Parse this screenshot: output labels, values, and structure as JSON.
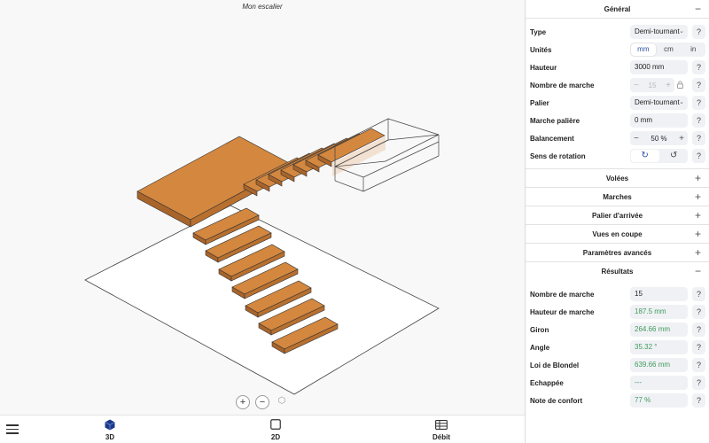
{
  "viewport": {
    "title": "Mon escalier",
    "zoom_in": "+",
    "zoom_out": "−",
    "reset_icon": "cube-outline-icon"
  },
  "bottom_nav": {
    "tabs": [
      {
        "label": "3D",
        "icon": "cube-icon",
        "active": true
      },
      {
        "label": "2D",
        "icon": "square-icon",
        "active": false
      },
      {
        "label": "Débit",
        "icon": "table-icon",
        "active": false
      }
    ]
  },
  "panel": {
    "general": {
      "title": "Général",
      "toggle": "−",
      "type": {
        "label": "Type",
        "value": "Demi-tournant"
      },
      "units": {
        "label": "Unités",
        "options": [
          "mm",
          "cm",
          "in"
        ],
        "selected": "mm"
      },
      "hauteur": {
        "label": "Hauteur",
        "value": "3000 mm"
      },
      "nb_marche": {
        "label": "Nombre de marche",
        "value": "15",
        "minus": "−",
        "plus": "+"
      },
      "palier": {
        "label": "Palier",
        "value": "Demi-tournant"
      },
      "marche_paliere": {
        "label": "Marche palière",
        "value": "0 mm"
      },
      "balancement": {
        "label": "Balancement",
        "value": "50 %",
        "minus": "−",
        "plus": "+"
      },
      "rotation": {
        "label": "Sens de rotation",
        "options": [
          "↻",
          "↺"
        ],
        "selected": 0
      }
    },
    "sections": [
      {
        "title": "Volées",
        "toggle": "+"
      },
      {
        "title": "Marches",
        "toggle": "+"
      },
      {
        "title": "Palier d'arrivée",
        "toggle": "+"
      },
      {
        "title": "Vues en coupe",
        "toggle": "+"
      },
      {
        "title": "Paramètres avancés",
        "toggle": "+"
      }
    ],
    "results": {
      "title": "Résultats",
      "toggle": "−",
      "rows": [
        {
          "label": "Nombre de marche",
          "value": "15",
          "green": false
        },
        {
          "label": "Hauteur de marche",
          "value": "187.5 mm",
          "green": true
        },
        {
          "label": "Giron",
          "value": "264.66 mm",
          "green": true
        },
        {
          "label": "Angle",
          "value": "35.32 °",
          "green": true
        },
        {
          "label": "Loi de Blondel",
          "value": "639.66 mm",
          "green": true
        },
        {
          "label": "Echappée",
          "value": "---",
          "green": true
        },
        {
          "label": "Note de confort",
          "value": "77 %",
          "green": true
        }
      ]
    },
    "help": "?"
  },
  "colors": {
    "wood_top": "#d3873f",
    "wood_side": "#a9642a",
    "accent": "#2a4ea8",
    "result_green": "#3f9b5f"
  }
}
